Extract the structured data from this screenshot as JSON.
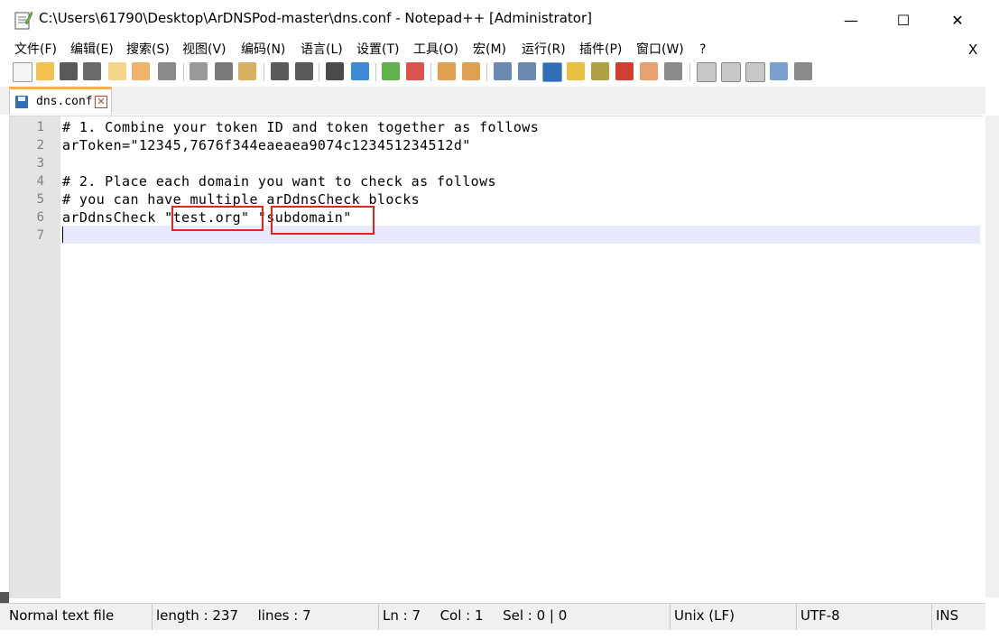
{
  "window": {
    "title": "C:\\Users\\61790\\Desktop\\ArDNSPod-master\\dns.conf - Notepad++ [Administrator]",
    "minimize": "—",
    "maximize": "☐",
    "close": "✕"
  },
  "menu": {
    "items": [
      "文件(F)",
      "编辑(E)",
      "搜索(S)",
      "视图(V)",
      "编码(N)",
      "语言(L)",
      "设置(T)",
      "工具(O)",
      "宏(M)",
      "运行(R)",
      "插件(P)",
      "窗口(W)",
      "?"
    ],
    "close": "X"
  },
  "toolbar": {
    "icons": [
      "new-file-icon",
      "open-file-icon",
      "save-icon",
      "save-all-icon",
      "close-icon",
      "close-all-icon",
      "print-icon",
      "cut-icon",
      "copy-icon",
      "paste-icon",
      "undo-icon",
      "redo-icon",
      "find-icon",
      "replace-icon",
      "zoom-in-icon",
      "zoom-out-icon",
      "sync-vertical-icon",
      "sync-horizontal-icon",
      "word-wrap-icon",
      "show-all-chars-icon",
      "indent-guide-icon",
      "udl-icon",
      "doc-map-icon",
      "function-list-icon",
      "folder-workspace-icon",
      "monitoring-icon",
      "record-macro-icon",
      "stop-macro-icon",
      "play-macro-icon",
      "run-macro-multiple-icon",
      "save-macro-icon"
    ]
  },
  "tab": {
    "label": "dns.conf",
    "close": "✕"
  },
  "editor": {
    "line_numbers": [
      "1",
      "2",
      "3",
      "4",
      "5",
      "6",
      "7"
    ],
    "lines": [
      "# 1. Combine your token ID and token together as follows",
      "arToken=\"12345,7676f344eaeaea9074c123451234512d\"",
      "",
      "# 2. Place each domain you want to check as follows",
      "# you can have multiple arDdnsCheck blocks",
      "arDdnsCheck \"test.org\" \"subdomain\"",
      ""
    ],
    "current_line": 7,
    "highlight_color": "#e2261b"
  },
  "status": {
    "file_type": "Normal text file",
    "length": "length : 237",
    "lines": "lines : 7",
    "ln": "Ln : 7",
    "col": "Col : 1",
    "sel": "Sel : 0 | 0",
    "eol": "Unix (LF)",
    "encoding": "UTF-8",
    "mode": "INS"
  }
}
